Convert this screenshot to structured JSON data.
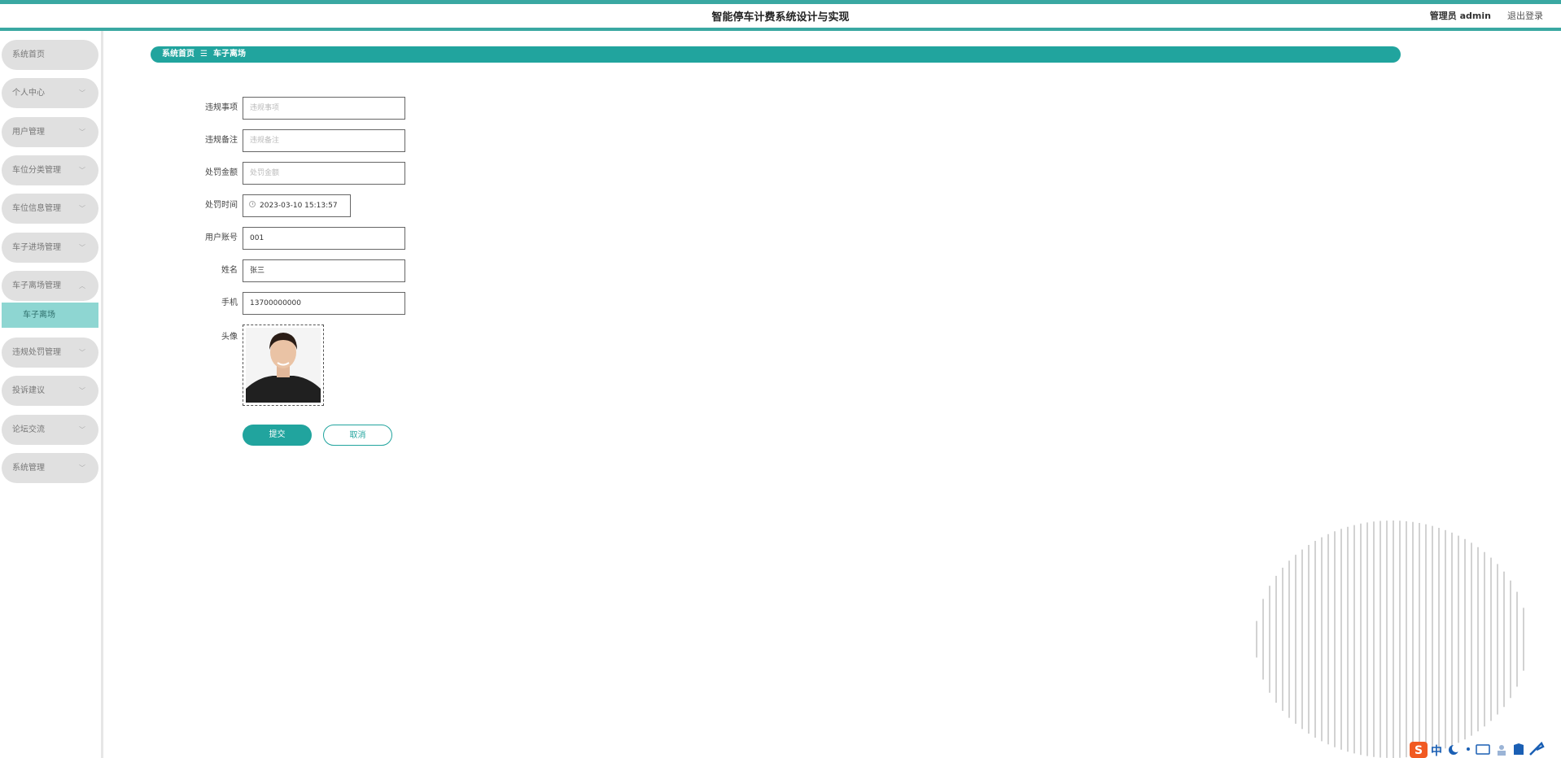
{
  "header": {
    "title": "智能停车计费系统设计与实现",
    "user": "管理员 admin",
    "logout": "退出登录"
  },
  "sidebar": {
    "items": [
      {
        "label": "系统首页",
        "has_chevron": false
      },
      {
        "label": "个人中心",
        "has_chevron": true
      },
      {
        "label": "用户管理",
        "has_chevron": true
      },
      {
        "label": "车位分类管理",
        "has_chevron": true
      },
      {
        "label": "车位信息管理",
        "has_chevron": true
      },
      {
        "label": "车子进场管理",
        "has_chevron": true
      },
      {
        "label": "车子离场管理",
        "has_chevron": true,
        "expanded": true
      },
      {
        "label": "违规处罚管理",
        "has_chevron": true
      },
      {
        "label": "投诉建议",
        "has_chevron": true
      },
      {
        "label": "论坛交流",
        "has_chevron": true
      },
      {
        "label": "系统管理",
        "has_chevron": true
      }
    ],
    "submenu": {
      "label": "车子离场"
    }
  },
  "breadcrumb": {
    "home": "系统首页",
    "separator": "☰",
    "current": "车子离场"
  },
  "form": {
    "violation_item": {
      "label": "违规事项",
      "placeholder": "违规事项",
      "value": ""
    },
    "violation_note": {
      "label": "违规备注",
      "placeholder": "违规备注",
      "value": ""
    },
    "penalty_amount": {
      "label": "处罚金额",
      "placeholder": "处罚金额",
      "value": ""
    },
    "penalty_time": {
      "label": "处罚时间",
      "value": "2023-03-10 15:13:57"
    },
    "user_account": {
      "label": "用户账号",
      "value": "001"
    },
    "name": {
      "label": "姓名",
      "value": "张三"
    },
    "phone": {
      "label": "手机",
      "value": "13700000000"
    },
    "avatar": {
      "label": "头像"
    }
  },
  "buttons": {
    "submit": "提交",
    "cancel": "取消"
  },
  "colors": {
    "accent": "#21a49e",
    "submenu_bg": "#8ed6d2",
    "menu_bg": "#e0e0e0"
  }
}
